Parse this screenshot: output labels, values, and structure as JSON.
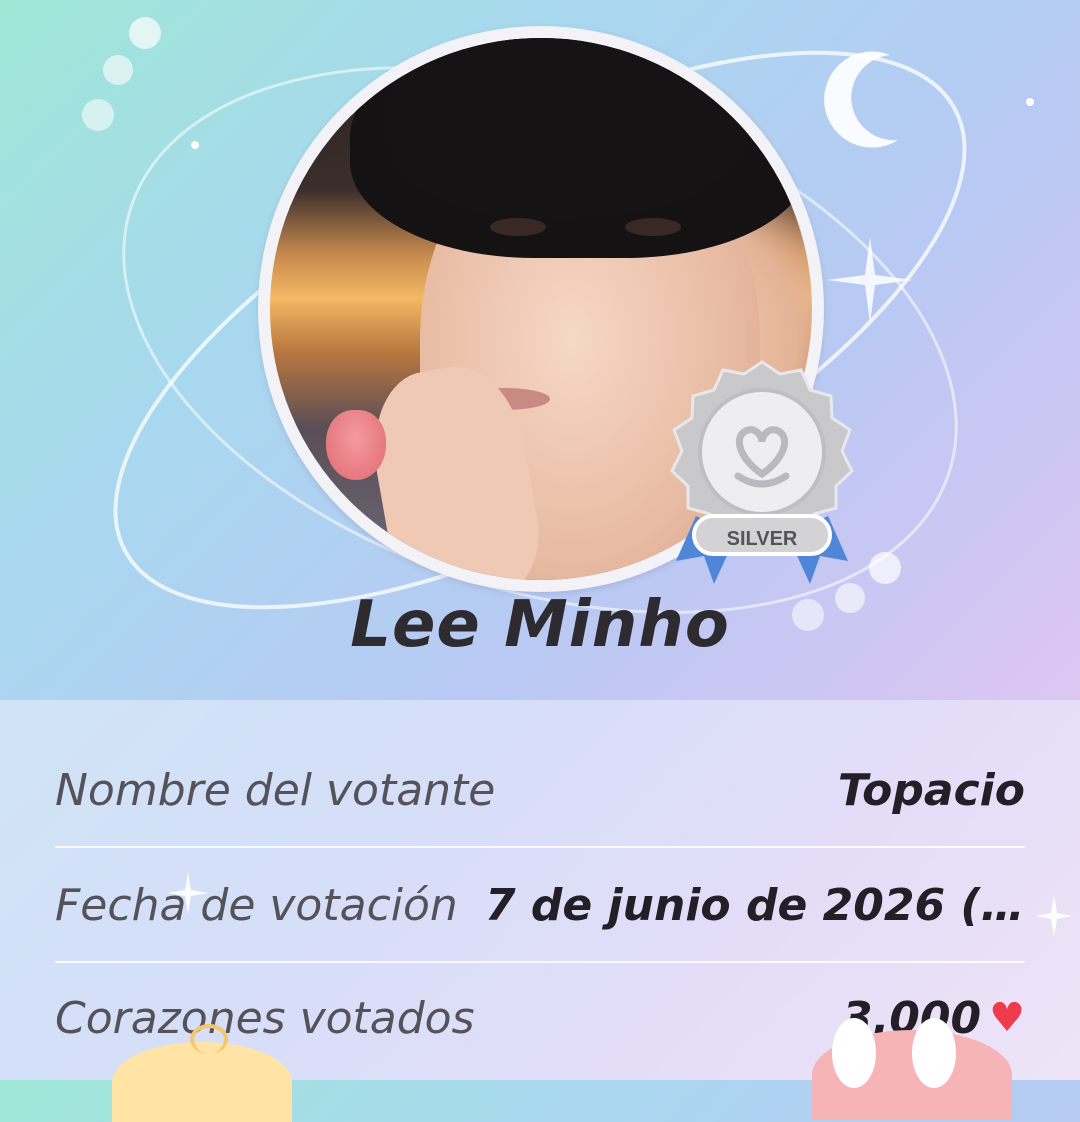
{
  "profile": {
    "name": "Lee Minho",
    "badge_label": "SILVER"
  },
  "info": {
    "voter_label": "Nombre del votante",
    "voter_value": "Topacio",
    "date_label": "Fecha de votación",
    "date_value": "7 de junio de 2026 (...",
    "hearts_label": "Corazones votados",
    "hearts_value": "3.000"
  },
  "colors": {
    "heart": "#ef3c4c",
    "badge_ribbon": "#4f86d8",
    "badge_medal": "#c9c9cc"
  },
  "icons": [
    "moon-icon",
    "sparkle-icon",
    "heart-icon",
    "silver-medal-icon"
  ]
}
